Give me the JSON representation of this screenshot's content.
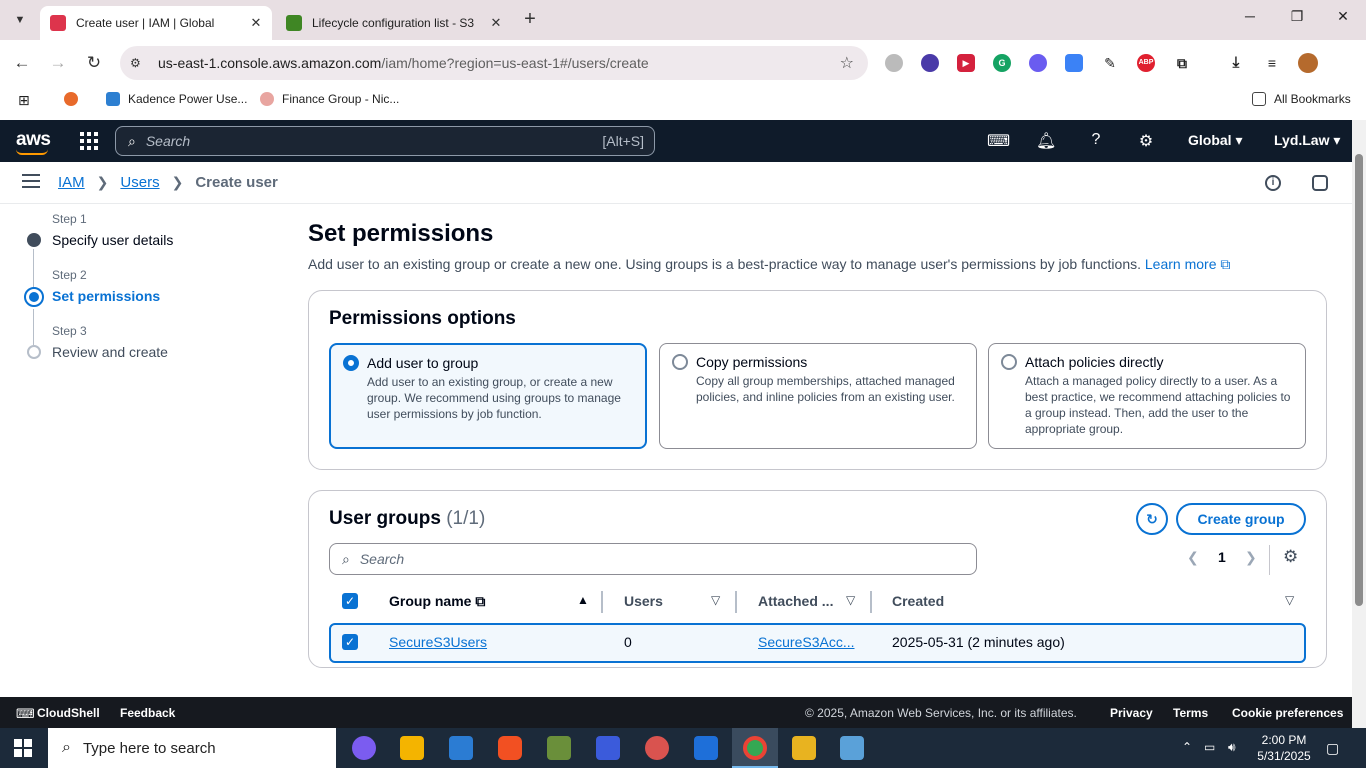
{
  "browser": {
    "tabs": [
      {
        "title": "Create user | IAM | Global",
        "active": true
      },
      {
        "title": "Lifecycle configuration list - S3",
        "active": false
      }
    ],
    "url_host": "us-east-1.console.aws.amazon.com",
    "url_path": "/iam/home?region=us-east-1#/users/create",
    "bookmarks": [
      "Kadence Power Use...",
      "Finance Group - Nic..."
    ],
    "all_bookmarks": "All Bookmarks"
  },
  "aws_nav": {
    "logo": "aws",
    "search_placeholder": "Search",
    "search_shortcut": "[Alt+S]",
    "region": "Global ▾",
    "account": "Lyd.Law ▾"
  },
  "breadcrumb": {
    "iam": "IAM",
    "users": "Users",
    "current": "Create user"
  },
  "steps": [
    {
      "label": "Step 1",
      "name": "Specify user details",
      "state": "done"
    },
    {
      "label": "Step 2",
      "name": "Set permissions",
      "state": "current"
    },
    {
      "label": "Step 3",
      "name": "Review and create",
      "state": "pending"
    }
  ],
  "main": {
    "title": "Set permissions",
    "description": "Add user to an existing group or create a new one. Using groups is a best-practice way to manage user's permissions by job functions.",
    "learn_more": "Learn more"
  },
  "permissions": {
    "title": "Permissions options",
    "options": [
      {
        "title": "Add user to group",
        "desc": "Add user to an existing group, or create a new group. We recommend using groups to manage user permissions by job function.",
        "selected": true
      },
      {
        "title": "Copy permissions",
        "desc": "Copy all group memberships, attached managed policies, and inline policies from an existing user.",
        "selected": false
      },
      {
        "title": "Attach policies directly",
        "desc": "Attach a managed policy directly to a user. As a best practice, we recommend attaching policies to a group instead. Then, add the user to the appropriate group.",
        "selected": false
      }
    ]
  },
  "groups": {
    "title": "User groups",
    "count": "(1/1)",
    "create_button": "Create group",
    "search_placeholder": "Search",
    "page": "1",
    "columns": [
      "Group name",
      "Users",
      "Attached ...",
      "Created"
    ],
    "rows": [
      {
        "name": "SecureS3Users",
        "users": "0",
        "attached": "SecureS3Acc...",
        "created": "2025-05-31 (2 minutes ago)"
      }
    ]
  },
  "footer": {
    "cloudshell": "CloudShell",
    "feedback": "Feedback",
    "copyright": "© 2025, Amazon Web Services, Inc. or its affiliates.",
    "privacy": "Privacy",
    "terms": "Terms",
    "cookies": "Cookie preferences"
  },
  "taskbar": {
    "search_placeholder": "Type here to search",
    "time": "2:00 PM",
    "date": "5/31/2025"
  },
  "colors": {
    "accent": "#0972d3",
    "aws_nav_bg": "#0f1b2a",
    "footer_bg": "#16191f"
  }
}
